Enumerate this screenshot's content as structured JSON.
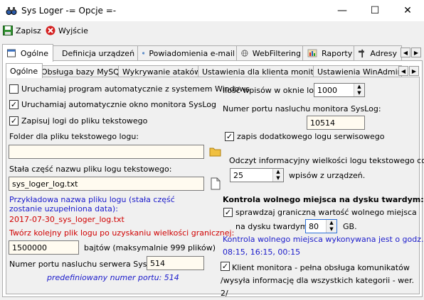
{
  "window": {
    "title": "Sys Loger -= Opcje =-",
    "minimize": "—",
    "maximize": "☐",
    "close": "✕"
  },
  "toolbar": {
    "save_label": "Zapisz",
    "exit_label": "Wyjście"
  },
  "main_tabs": [
    "Ogólne",
    "Definicja urządzeń",
    "Powiadomienia e-mail",
    "WebFiltering",
    "Raporty",
    "Adresy"
  ],
  "sub_tabs": [
    "Ogólne",
    "Obsługa bazy MySQL",
    "Wykrywanie ataków",
    "Ustawienia dla klienta monitora",
    "Ustawienia WinAdmin Mo"
  ],
  "left": {
    "autostart": {
      "label": "Uruchamiaj program automatycznie z systemem Windows",
      "checked": false
    },
    "auto_monitor": {
      "label": "Uruchamiaj automatycznie okno monitora SysLog",
      "checked": true
    },
    "save_logs": {
      "label": "Zapisuj logi do pliku tekstowego",
      "checked": true
    },
    "folder_label": "Folder dla pliku tekstowego logu:",
    "folder_value": "",
    "name_label": "Stała część nazwu pliku logu tekstowego:",
    "name_value": "sys_loger_log.txt",
    "example_label": "Przykładowa nazwa pliku logu (stała część zostanie uzupełniona data):",
    "example_value": "2017-07-30_sys_loger_log.txt",
    "new_file_label": "Twórz kolejny plik logu po uzyskaniu wielkości granicznej:",
    "size_value": "1500000",
    "size_unit": "bajtów (maksymalnie 999 plików)",
    "port_label": "Numer portu nasluchu serwera SysLog:",
    "port_value": "514",
    "predef_label": "predefiniowany numer portu: 514"
  },
  "right": {
    "rows_label": "Ilość wpisów w oknie logu:",
    "rows_value": "1000",
    "monitor_port_label": "Numer portu nasluchu monitora SysLog:",
    "monitor_port_value": "10514",
    "service_log": {
      "label": "zapis dodatkowego logu serwisowego",
      "checked": true
    },
    "read_label": "Odczyt informacyjny wielkości logu tekstowego co",
    "read_value": "25",
    "read_unit": "wpisów z urządzeń.",
    "disk_title": "Kontrola wolnego miejsca na dysku twardym:",
    "disk_check": {
      "label": "sprawdzaj graniczną wartość wolnego miejsca",
      "checked": true
    },
    "disk_label": "na dysku twardym:",
    "disk_value": "80",
    "disk_unit": "GB.",
    "disk_times_label": "Kontrola wolnego miejsca wykonywana jest o godz.:",
    "disk_times": "08:15, 16:15, 00:15",
    "client": {
      "label": "Klient monitora - pełna obsługa komunikatów /wysyła informację dla wszystkich kategorii - wer. 2/",
      "checked": true
    }
  },
  "colors": {
    "red": "#d00000",
    "blue": "#1b1bcb",
    "field_bg": "#fffbf0"
  }
}
